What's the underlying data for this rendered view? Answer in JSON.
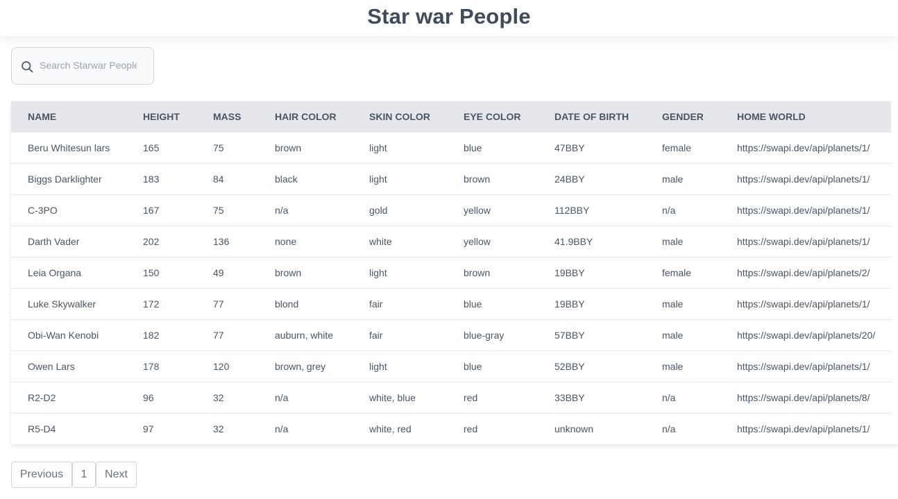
{
  "header": {
    "title": "Star war People"
  },
  "search": {
    "placeholder": "Search Starwar People"
  },
  "table": {
    "columns": [
      "NAME",
      "HEIGHT",
      "MASS",
      "HAIR COLOR",
      "SKIN COLOR",
      "EYE COLOR",
      "DATE OF BIRTH",
      "GENDER",
      "HOME WORLD"
    ],
    "rows": [
      [
        "Beru Whitesun lars",
        "165",
        "75",
        "brown",
        "light",
        "blue",
        "47BBY",
        "female",
        "https://swapi.dev/api/planets/1/"
      ],
      [
        "Biggs Darklighter",
        "183",
        "84",
        "black",
        "light",
        "brown",
        "24BBY",
        "male",
        "https://swapi.dev/api/planets/1/"
      ],
      [
        "C-3PO",
        "167",
        "75",
        "n/a",
        "gold",
        "yellow",
        "112BBY",
        "n/a",
        "https://swapi.dev/api/planets/1/"
      ],
      [
        "Darth Vader",
        "202",
        "136",
        "none",
        "white",
        "yellow",
        "41.9BBY",
        "male",
        "https://swapi.dev/api/planets/1/"
      ],
      [
        "Leia Organa",
        "150",
        "49",
        "brown",
        "light",
        "brown",
        "19BBY",
        "female",
        "https://swapi.dev/api/planets/2/"
      ],
      [
        "Luke Skywalker",
        "172",
        "77",
        "blond",
        "fair",
        "blue",
        "19BBY",
        "male",
        "https://swapi.dev/api/planets/1/"
      ],
      [
        "Obi-Wan Kenobi",
        "182",
        "77",
        "auburn, white",
        "fair",
        "blue-gray",
        "57BBY",
        "male",
        "https://swapi.dev/api/planets/20/"
      ],
      [
        "Owen Lars",
        "178",
        "120",
        "brown, grey",
        "light",
        "blue",
        "52BBY",
        "male",
        "https://swapi.dev/api/planets/1/"
      ],
      [
        "R2-D2",
        "96",
        "32",
        "n/a",
        "white, blue",
        "red",
        "33BBY",
        "n/a",
        "https://swapi.dev/api/planets/8/"
      ],
      [
        "R5-D4",
        "97",
        "32",
        "n/a",
        "white, red",
        "red",
        "unknown",
        "n/a",
        "https://swapi.dev/api/planets/1/"
      ]
    ]
  },
  "pagination": {
    "previous_label": "Previous",
    "current_page": "1",
    "next_label": "Next"
  },
  "colors": {
    "title": "#3f4b5b",
    "table_header_bg": "#e5e7eb",
    "text": "#4b5563",
    "border": "#d1d5db"
  },
  "icons": {
    "search": "search-icon"
  }
}
